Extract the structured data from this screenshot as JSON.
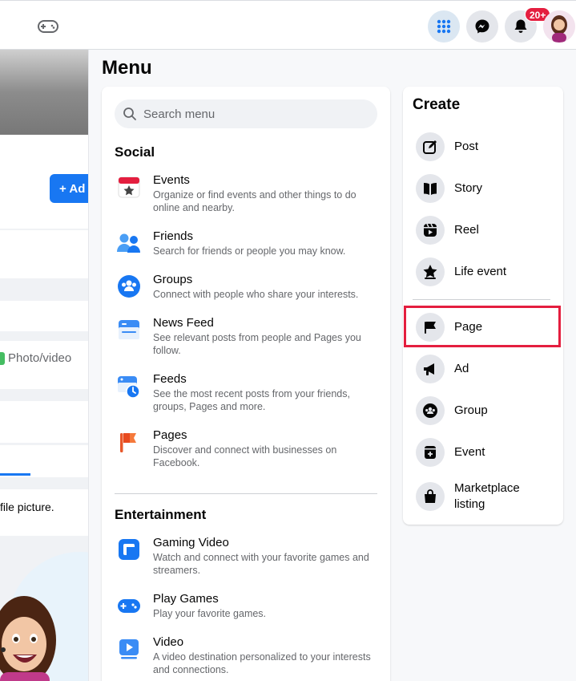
{
  "topbar": {
    "notifications_badge": "20+",
    "icons": [
      "gaming-icon",
      "menu-grid-icon",
      "messenger-icon",
      "bell-icon",
      "avatar"
    ]
  },
  "background_page": {
    "add_button_label": "+ Ad",
    "photo_video_label": "Photo/video",
    "profile_text": "file picture."
  },
  "menu": {
    "title": "Menu",
    "search": {
      "placeholder": "Search menu",
      "value": ""
    },
    "social": {
      "title": "Social",
      "items": [
        {
          "name": "Events",
          "desc": "Organize or find events and other things to do online and nearby.",
          "icon": "calendar-icon"
        },
        {
          "name": "Friends",
          "desc": "Search for friends or people you may know.",
          "icon": "friends-icon"
        },
        {
          "name": "Groups",
          "desc": "Connect with people who share your interests.",
          "icon": "groups-icon"
        },
        {
          "name": "News Feed",
          "desc": "See relevant posts from people and Pages you follow.",
          "icon": "news-feed-icon"
        },
        {
          "name": "Feeds",
          "desc": "See the most recent posts from your friends, groups, Pages and more.",
          "icon": "feeds-icon"
        },
        {
          "name": "Pages",
          "desc": "Discover and connect with businesses on Facebook.",
          "icon": "pages-flag-icon"
        }
      ]
    },
    "entertainment": {
      "title": "Entertainment",
      "items": [
        {
          "name": "Gaming Video",
          "desc": "Watch and connect with your favorite games and streamers.",
          "icon": "gaming-video-icon"
        },
        {
          "name": "Play Games",
          "desc": "Play your favorite games.",
          "icon": "gamepad-icon"
        },
        {
          "name": "Video",
          "desc": "A video destination personalized to your interests and connections.",
          "icon": "video-icon"
        }
      ]
    },
    "create": {
      "title": "Create",
      "items": [
        {
          "label": "Post",
          "icon": "edit-icon"
        },
        {
          "label": "Story",
          "icon": "book-icon"
        },
        {
          "label": "Reel",
          "icon": "reel-icon"
        },
        {
          "label": "Life event",
          "icon": "star-icon"
        },
        {
          "label": "Page",
          "icon": "flag-icon"
        },
        {
          "label": "Ad",
          "icon": "megaphone-icon"
        },
        {
          "label": "Group",
          "icon": "group-icon"
        },
        {
          "label": "Event",
          "icon": "event-plus-icon"
        },
        {
          "label": "Marketplace listing",
          "icon": "shopping-bag-icon"
        }
      ]
    }
  },
  "colors": {
    "accent": "#1877f2",
    "badge": "#e41e3f",
    "highlight": "#e41e3f"
  }
}
